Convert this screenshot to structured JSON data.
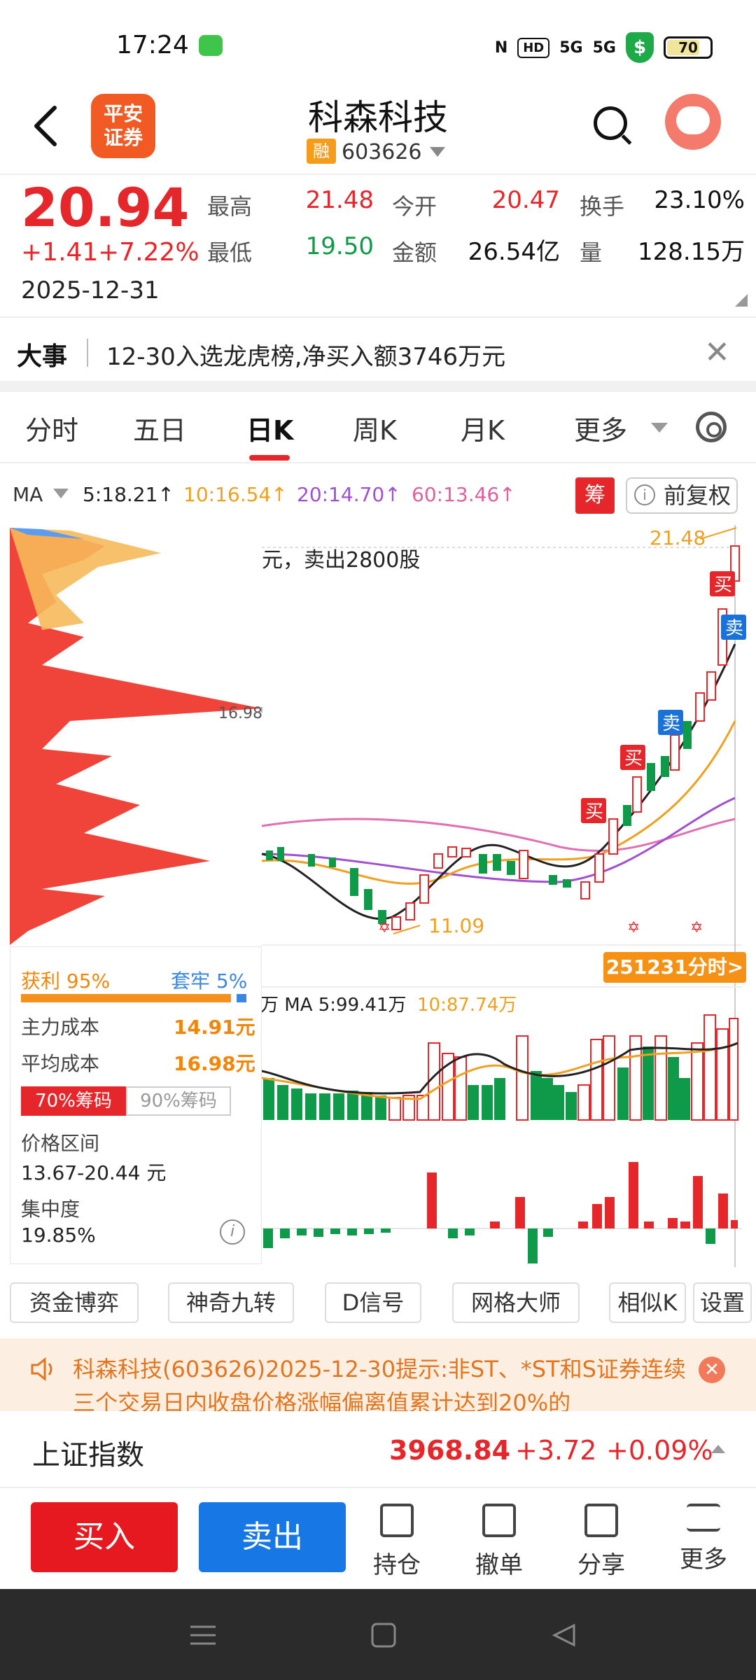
{
  "status": {
    "time": "17:24",
    "signal1": "5G",
    "signal2": "5G",
    "hd": "HD",
    "battery": "70"
  },
  "header": {
    "logo_line1": "平安",
    "logo_line2": "证券",
    "stock_name": "科森科技",
    "rong_badge": "融",
    "stock_code": "603626"
  },
  "quote": {
    "price": "20.94",
    "change": "+1.41",
    "change_pct": "+7.22%",
    "date": "2025-12-31",
    "high_label": "最高",
    "high": "21.48",
    "open_label": "今开",
    "open": "20.47",
    "turnover_label": "换手",
    "turnover": "23.10%",
    "low_label": "最低",
    "low": "19.50",
    "amount_label": "金额",
    "amount": "26.54亿",
    "volume_label": "量",
    "volume": "128.15万"
  },
  "news": {
    "tag": "大事",
    "text": "12-30入选龙虎榜,净买入额3746万元"
  },
  "tabs": [
    "分时",
    "五日",
    "日K",
    "周K",
    "月K",
    "更多"
  ],
  "ma": {
    "label": "MA",
    "ma5": "5:18.21↑",
    "ma10": "10:16.54↑",
    "ma20": "20:14.70↑",
    "ma60": "60:13.46↑",
    "chou": "筹",
    "fuquan": "前复权"
  },
  "chart": {
    "high_mark": "21.48",
    "low_mark": "11.09",
    "chip_price_mark": "16.98",
    "trade_tip": "元，卖出2800股",
    "buy_tag": "买",
    "sell_tag": "卖",
    "time_button": "251231分时>",
    "vol_ma_line": "万 MA 5:99.41万",
    "vol_ma10": "10:87.74万"
  },
  "chip": {
    "profit_label": "获利 95%",
    "trap_label": "套牢 5%",
    "main_cost_label": "主力成本",
    "main_cost": "14.91元",
    "avg_cost_label": "平均成本",
    "avg_cost": "16.98元",
    "tab70": "70%筹码",
    "tab90": "90%筹码",
    "range_label": "价格区间",
    "range_value": "13.67-20.44 元",
    "conc_label": "集中度",
    "conc_value": "19.85%"
  },
  "features": [
    "资金博弈",
    "神奇九转",
    "D信号",
    "网格大师",
    "相似K",
    "设置"
  ],
  "alert": {
    "text": "科森科技(603626)2025-12-30提示:非ST、*ST和S证券连续三个交易日内收盘价格涨幅偏离值累计达到20%的"
  },
  "index": {
    "name": "上证指数",
    "value": "3968.84",
    "change": "+3.72",
    "pct": "+0.09%"
  },
  "toolbar": {
    "buy": "买入",
    "sell": "卖出",
    "hold": "持仓",
    "cancel": "撤单",
    "share": "分享",
    "more": "更多"
  }
}
